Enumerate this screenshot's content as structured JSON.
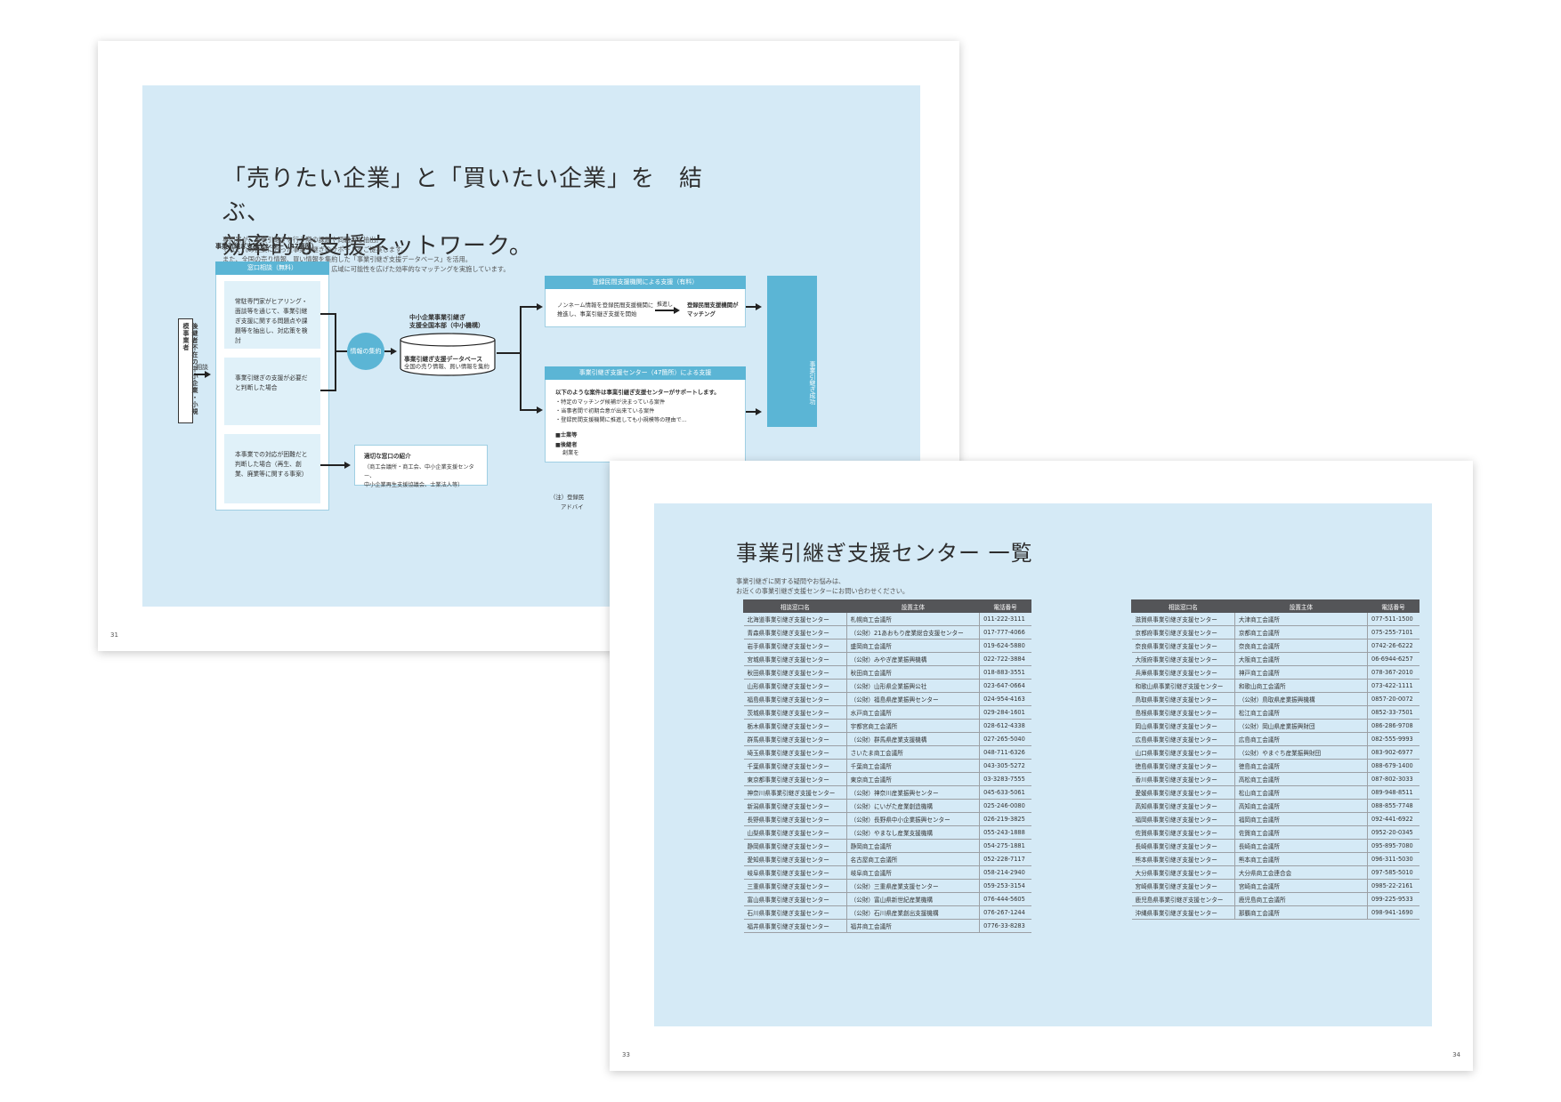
{
  "back_page": {
    "page_number": "31",
    "title_line1": "「売りたい企業」と「買いたい企業」を　結ぶ、",
    "title_line2": "効率的な支援ネットワーク。",
    "body_lines": [
      "専門家が、事業引継ぎを行う際の課題や問題点を抽出。",
      "それぞれの企業に合った事業引継ぎのサポートをご提案します。",
      "また、全国の売り情報、買い情報を集約した「事業引継ぎ支援データベース」を活用。",
      "登録民間支援機関の情報とリンクし、広域に可能性を広げた効率的なマッチングを実施しています。"
    ],
    "diagram": {
      "client_label": "後継者不在の中小企業・小規模事業者",
      "consult_label": "相談",
      "center_title": "事業引継ぎ支援センター（47箇所）",
      "window_header": "窓口相談（無料）",
      "box1": "常駐専門家がヒアリング・面談等を通じて、事業引継ぎ支援に関する問題点や課題等を抽出し、対応策を検討",
      "box2": "事業引継ぎの支援が必要だと判断した場合",
      "box3": "本事業での対応が困難だと判断した場合（再生、創業、廃業等に関する事案）",
      "aggregate_label": "情報の集約",
      "hq_label_line1": "中小企業事業引継ぎ",
      "hq_label_line2": "支援全国本部（中小機構）",
      "db_label_line1": "事業引継ぎ支援データベース",
      "db_label_line2": "全国の売り情報、買い情報を集約",
      "referral_title": "適切な窓口の紹介",
      "referral_line1": "（商工会議所・商工会、中小企業支援センター、",
      "referral_line2": "中小企業再生支援協議会、士業法人等）",
      "private_header": "登録民間支援機関による支援（有料）",
      "private_text_line1": "ノンネーム情報を登録民間支援機関に",
      "private_text_line2": "推進し、事業引継ぎ支援を開始",
      "private_small": "推進し",
      "private_result_line1": "登録民間支援機関が",
      "private_result_line2": "マッチング",
      "center_support_header": "事業引継ぎ支援センター（47箇所）による支援",
      "center_support_intro": "以下のような案件は事業引継ぎ支援センターがサポートします。",
      "center_support_items": [
        "・特定のマッチング候補が決まっている案件",
        "・当事者間で初期合意が出来ている案件",
        "・登録民間支援機関に推進しても小規模等の理由で..."
      ],
      "center_support_extra1": "■士業等",
      "center_support_extra2": "■後継者",
      "center_support_extra3": "創業を",
      "success_label": "事業引継ぎ成功",
      "note_line1": "（注）登録民",
      "note_line2": "アドバイ"
    }
  },
  "front_page": {
    "page_number_left": "33",
    "page_number_right": "34",
    "title": "事業引継ぎ支援センター 一覧",
    "body_lines": [
      "事業引継ぎに関する疑問やお悩みは、",
      "お近くの事業引継ぎ支援センターにお問い合わせください。"
    ],
    "headers": [
      "相談窓口名",
      "設置主体",
      "電話番号"
    ],
    "left_rows": [
      [
        "北海道事業引継ぎ支援センター",
        "札幌商工会議所",
        "011-222-3111"
      ],
      [
        "青森県事業引継ぎ支援センター",
        "（公財）21あおもり産業総合支援センター",
        "017-777-4066"
      ],
      [
        "岩手県事業引継ぎ支援センター",
        "盛岡商工会議所",
        "019-624-5880"
      ],
      [
        "宮城県事業引継ぎ支援センター",
        "（公財）みやぎ産業振興機構",
        "022-722-3884"
      ],
      [
        "秋田県事業引継ぎ支援センター",
        "秋田商工会議所",
        "018-883-3551"
      ],
      [
        "山形県事業引継ぎ支援センター",
        "（公財）山形県企業振興公社",
        "023-647-0664"
      ],
      [
        "福島県事業引継ぎ支援センター",
        "（公財）福島県産業振興センター",
        "024-954-4163"
      ],
      [
        "茨城県事業引継ぎ支援センター",
        "水戸商工会議所",
        "029-284-1601"
      ],
      [
        "栃木県事業引継ぎ支援センター",
        "宇都宮商工会議所",
        "028-612-4338"
      ],
      [
        "群馬県事業引継ぎ支援センター",
        "（公財）群馬県産業支援機構",
        "027-265-5040"
      ],
      [
        "埼玉県事業引継ぎ支援センター",
        "さいたま商工会議所",
        "048-711-6326"
      ],
      [
        "千葉県事業引継ぎ支援センター",
        "千葉商工会議所",
        "043-305-5272"
      ],
      [
        "東京都事業引継ぎ支援センター",
        "東京商工会議所",
        "03-3283-7555"
      ],
      [
        "神奈川県事業引継ぎ支援センター",
        "（公財）神奈川産業振興センター",
        "045-633-5061"
      ],
      [
        "新潟県事業引継ぎ支援センター",
        "（公財）にいがた産業創造機構",
        "025-246-0080"
      ],
      [
        "長野県事業引継ぎ支援センター",
        "（公財）長野県中小企業振興センター",
        "026-219-3825"
      ],
      [
        "山梨県事業引継ぎ支援センター",
        "（公財）やまなし産業支援機構",
        "055-243-1888"
      ],
      [
        "静岡県事業引継ぎ支援センター",
        "静岡商工会議所",
        "054-275-1881"
      ],
      [
        "愛知県事業引継ぎ支援センター",
        "名古屋商工会議所",
        "052-228-7117"
      ],
      [
        "岐阜県事業引継ぎ支援センター",
        "岐阜商工会議所",
        "058-214-2940"
      ],
      [
        "三重県事業引継ぎ支援センター",
        "（公財）三重県産業支援センター",
        "059-253-3154"
      ],
      [
        "富山県事業引継ぎ支援センター",
        "（公財）富山県新世紀産業機構",
        "076-444-5605"
      ],
      [
        "石川県事業引継ぎ支援センター",
        "（公財）石川県産業創出支援機構",
        "076-267-1244"
      ],
      [
        "福井県事業引継ぎ支援センター",
        "福井商工会議所",
        "0776-33-8283"
      ]
    ],
    "right_rows": [
      [
        "滋賀県事業引継ぎ支援センター",
        "大津商工会議所",
        "077-511-1500"
      ],
      [
        "京都府事業引継ぎ支援センター",
        "京都商工会議所",
        "075-255-7101"
      ],
      [
        "奈良県事業引継ぎ支援センター",
        "奈良商工会議所",
        "0742-26-6222"
      ],
      [
        "大阪府事業引継ぎ支援センター",
        "大阪商工会議所",
        "06-6944-6257"
      ],
      [
        "兵庫県事業引継ぎ支援センター",
        "神戸商工会議所",
        "078-367-2010"
      ],
      [
        "和歌山県事業引継ぎ支援センター",
        "和歌山商工会議所",
        "073-422-1111"
      ],
      [
        "鳥取県事業引継ぎ支援センター",
        "（公財）鳥取県産業振興機構",
        "0857-20-0072"
      ],
      [
        "島根県事業引継ぎ支援センター",
        "松江商工会議所",
        "0852-33-7501"
      ],
      [
        "岡山県事業引継ぎ支援センター",
        "（公財）岡山県産業振興財団",
        "086-286-9708"
      ],
      [
        "広島県事業引継ぎ支援センター",
        "広島商工会議所",
        "082-555-9993"
      ],
      [
        "山口県事業引継ぎ支援センター",
        "（公財）やまぐち産業振興財団",
        "083-902-6977"
      ],
      [
        "徳島県事業引継ぎ支援センター",
        "徳島商工会議所",
        "088-679-1400"
      ],
      [
        "香川県事業引継ぎ支援センター",
        "高松商工会議所",
        "087-802-3033"
      ],
      [
        "愛媛県事業引継ぎ支援センター",
        "松山商工会議所",
        "089-948-8511"
      ],
      [
        "高知県事業引継ぎ支援センター",
        "高知商工会議所",
        "088-855-7748"
      ],
      [
        "福岡県事業引継ぎ支援センター",
        "福岡商工会議所",
        "092-441-6922"
      ],
      [
        "佐賀県事業引継ぎ支援センター",
        "佐賀商工会議所",
        "0952-20-0345"
      ],
      [
        "長崎県事業引継ぎ支援センター",
        "長崎商工会議所",
        "095-895-7080"
      ],
      [
        "熊本県事業引継ぎ支援センター",
        "熊本商工会議所",
        "096-311-5030"
      ],
      [
        "大分県事業引継ぎ支援センター",
        "大分県商工会連合会",
        "097-585-5010"
      ],
      [
        "宮崎県事業引継ぎ支援センター",
        "宮崎商工会議所",
        "0985-22-2161"
      ],
      [
        "鹿児島県事業引継ぎ支援センター",
        "鹿児島商工会議所",
        "099-225-9533"
      ],
      [
        "沖縄県事業引継ぎ支援センター",
        "那覇商工会議所",
        "098-941-1690"
      ]
    ]
  }
}
